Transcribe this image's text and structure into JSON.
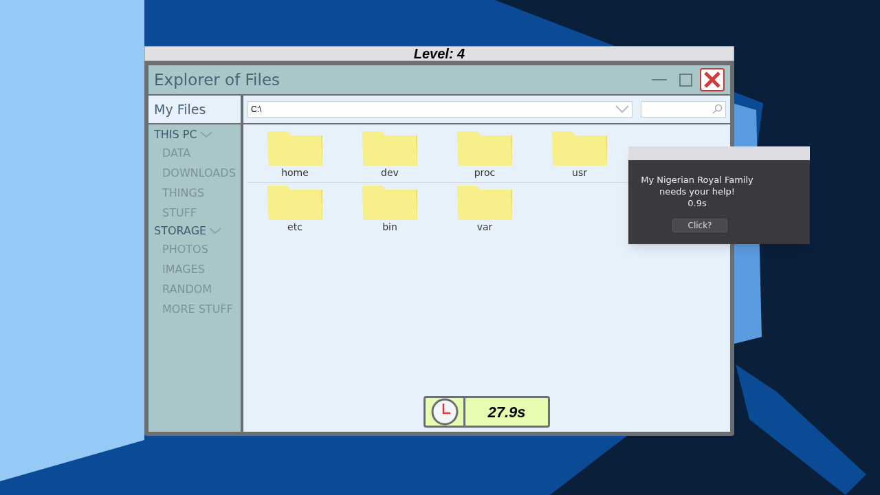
{
  "level_banner": "Level: 4",
  "window": {
    "title": "Explorer of Files"
  },
  "my_files": "My Files",
  "address": {
    "value": "C:\\"
  },
  "sidebar": [
    {
      "label": "THIS PC",
      "expanded": true,
      "children": [
        {
          "label": "DATA"
        },
        {
          "label": "DOWNLOADS"
        },
        {
          "label": "THINGS"
        },
        {
          "label": "STUFF"
        }
      ]
    },
    {
      "label": "STORAGE",
      "expanded": true,
      "children": [
        {
          "label": "PHOTOS"
        },
        {
          "label": "IMAGES"
        },
        {
          "label": "RANDOM"
        },
        {
          "label": "MORE STUFF"
        }
      ]
    }
  ],
  "folder_rows": [
    [
      {
        "name": "home"
      },
      {
        "name": "dev"
      },
      {
        "name": "proc"
      },
      {
        "name": "usr"
      }
    ],
    [
      {
        "name": "etc"
      },
      {
        "name": "bin"
      },
      {
        "name": "var"
      }
    ]
  ],
  "timer": "27.9s",
  "popup": {
    "message": "My Nigerian Royal Family needs your help!",
    "countdown": "0.9s",
    "button": "Click?"
  }
}
